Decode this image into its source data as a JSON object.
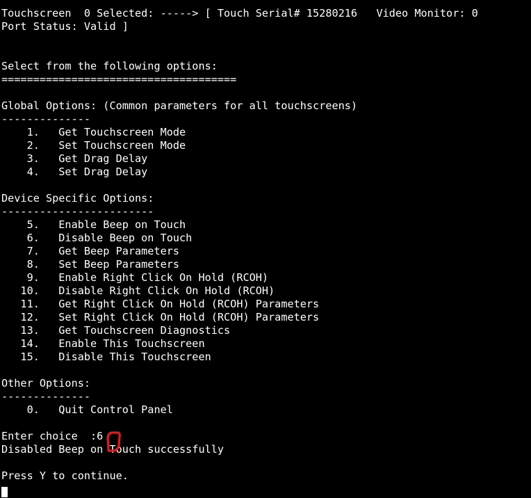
{
  "terminal": {
    "background_color": "#000000",
    "foreground_color": "#ffffff",
    "annotation_color": "#e01b1b",
    "status_line_1": "Touchscreen  0 Selected: -----> [ Touch Serial# 15280216   Video Monitor: 0",
    "status_line_2": "Port Status: Valid ]",
    "prompt_header": "Select from the following options:",
    "prompt_header_rule": "=====================================",
    "global_options_header": "Global Options: (Common parameters for all touchscreens)",
    "global_options_rule": "--------------",
    "global_options": [
      "    1.   Get Touchscreen Mode",
      "    2.   Set Touchscreen Mode",
      "    3.   Get Drag Delay",
      "    4.   Set Drag Delay"
    ],
    "device_options_header": "Device Specific Options:",
    "device_options_rule": "------------------------",
    "device_options": [
      "    5.   Enable Beep on Touch",
      "    6.   Disable Beep on Touch",
      "    7.   Get Beep Parameters",
      "    8.   Set Beep Parameters",
      "    9.   Enable Right Click On Hold (RCOH)",
      "   10.   Disable Right Click On Hold (RCOH)",
      "   11.   Get Right Click On Hold (RCOH) Parameters",
      "   12.   Set Right Click On Hold (RCOH) Parameters",
      "   13.   Get Touchscreen Diagnostics",
      "   14.   Enable This Touchscreen",
      "   15.   Disable This Touchscreen"
    ],
    "other_options_header": "Other Options:",
    "other_options_rule": "--------------",
    "other_options": [
      "    0.   Quit Control Panel"
    ],
    "enter_choice_line": "Enter choice  :6",
    "result_line": "Disabled Beep on Touch successfully",
    "continue_prompt": "Press Y to continue.",
    "full_screen_text": "Touchscreen  0 Selected: -----> [ Touch Serial# 15280216   Video Monitor: 0\nPort Status: Valid ]\n\n\nSelect from the following options:\n=====================================\n\nGlobal Options: (Common parameters for all touchscreens)\n--------------\n    1.   Get Touchscreen Mode\n    2.   Set Touchscreen Mode\n    3.   Get Drag Delay\n    4.   Set Drag Delay\n\nDevice Specific Options:\n------------------------\n    5.   Enable Beep on Touch\n    6.   Disable Beep on Touch\n    7.   Get Beep Parameters\n    8.   Set Beep Parameters\n    9.   Enable Right Click On Hold (RCOH)\n   10.   Disable Right Click On Hold (RCOH)\n   11.   Get Right Click On Hold (RCOH) Parameters\n   12.   Set Right Click On Hold (RCOH) Parameters\n   13.   Get Touchscreen Diagnostics\n   14.   Enable This Touchscreen\n   15.   Disable This Touchscreen\n\nOther Options:\n--------------\n    0.   Quit Control Panel\n\nEnter choice  :6\nDisabled Beep on Touch successfully\n\nPress Y to continue."
  },
  "annotation": {
    "shape": "hand-drawn-bracket-around-choice",
    "target_value": "6",
    "color": "#e01b1b"
  }
}
